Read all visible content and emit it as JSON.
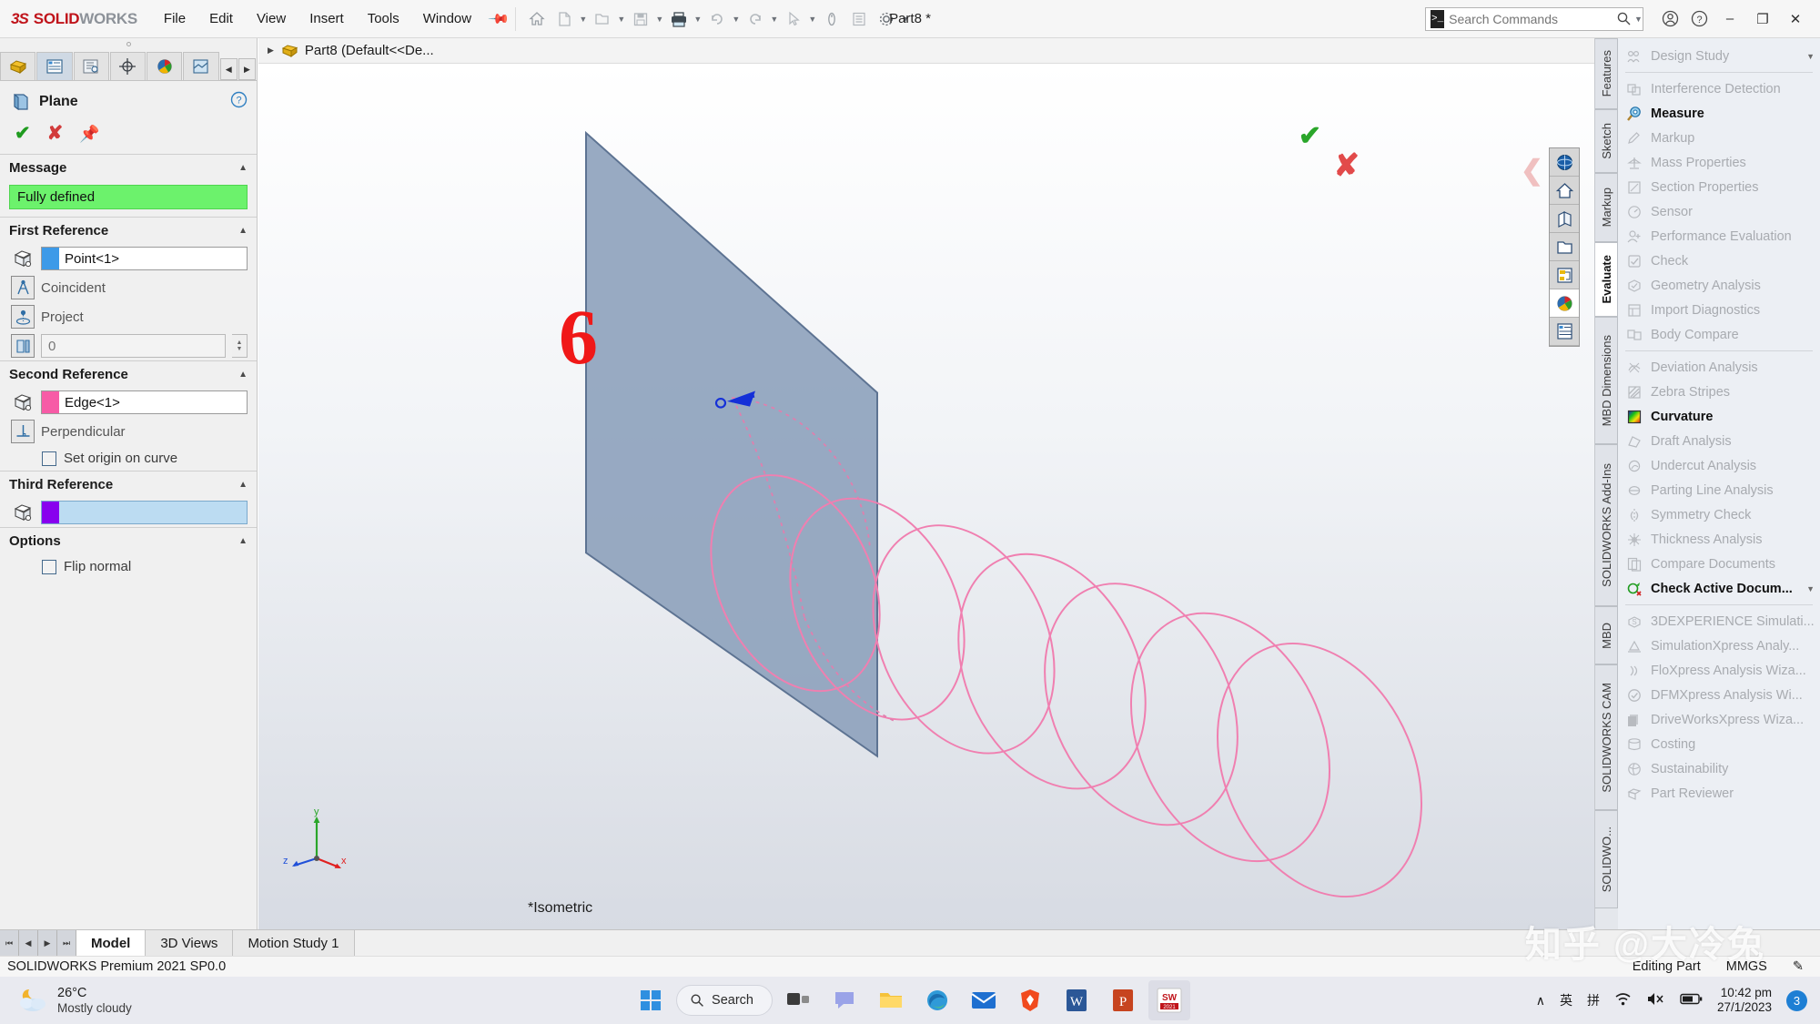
{
  "app": {
    "brand_ds": "3S",
    "brand_solid": "SOLID",
    "brand_works": "WORKS",
    "document_title": "Part8 *",
    "menus": [
      "File",
      "Edit",
      "View",
      "Insert",
      "Tools",
      "Window"
    ],
    "accent_red": "#c0141b"
  },
  "search": {
    "placeholder": "Search Commands",
    "value": ""
  },
  "left_panel": {
    "tabs": [
      "feature-manager-tab",
      "property-manager-tab",
      "configuration-manager-tab",
      "dimxpert-manager-tab",
      "display-manager-tab",
      "cam-manager-tab"
    ],
    "title": "Plane",
    "sections": {
      "message": {
        "header": "Message",
        "status": "Fully defined",
        "status_color": "#6cf26c"
      },
      "first_reference": {
        "header": "First Reference",
        "selection": "Point<1>",
        "selection_color": "#3d9ae8",
        "constraint1": "Coincident",
        "constraint2": "Project",
        "offset_value": "0"
      },
      "second_reference": {
        "header": "Second Reference",
        "selection": "Edge<1>",
        "selection_color": "#f75ba6",
        "constraint1": "Perpendicular",
        "checkbox": "Set origin on curve",
        "checked": false
      },
      "third_reference": {
        "header": "Third Reference",
        "selection": "",
        "selection_color": "#8800ee"
      },
      "options": {
        "header": "Options",
        "checkbox": "Flip normal",
        "checked": false
      }
    }
  },
  "graphics": {
    "doc_node": "Part8  (Default<<De...",
    "view_label": "*Isometric",
    "annotation_number": "6",
    "triad": {
      "x": "x",
      "y": "y",
      "z": "z"
    }
  },
  "right_panel": {
    "tabs": [
      "Features",
      "Sketch",
      "Markup",
      "Evaluate",
      "MBD Dimensions",
      "SOLIDWORKS Add-Ins",
      "MBD",
      "SOLIDWORKS CAM",
      "SOLIDWO..."
    ],
    "selected_tab": "Evaluate",
    "groups": [
      {
        "items": [
          {
            "label": "Design Study",
            "icon": "design-study-icon",
            "enabled": false,
            "dropdown": true
          }
        ]
      },
      {
        "items": [
          {
            "label": "Interference Detection",
            "icon": "interference-detection-icon",
            "enabled": false,
            "dropdown": false
          },
          {
            "label": "Measure",
            "icon": "measure-icon",
            "enabled": true,
            "dropdown": false
          },
          {
            "label": "Markup",
            "icon": "markup-icon",
            "enabled": false,
            "dropdown": false
          },
          {
            "label": "Mass Properties",
            "icon": "mass-properties-icon",
            "enabled": false,
            "dropdown": false
          },
          {
            "label": "Section Properties",
            "icon": "section-properties-icon",
            "enabled": false,
            "dropdown": false
          },
          {
            "label": "Sensor",
            "icon": "sensor-icon",
            "enabled": false,
            "dropdown": false
          },
          {
            "label": "Performance Evaluation",
            "icon": "performance-evaluation-icon",
            "enabled": false,
            "dropdown": false
          },
          {
            "label": "Check",
            "icon": "check-icon",
            "enabled": false,
            "dropdown": false
          },
          {
            "label": "Geometry Analysis",
            "icon": "geometry-analysis-icon",
            "enabled": false,
            "dropdown": false
          },
          {
            "label": "Import Diagnostics",
            "icon": "import-diagnostics-icon",
            "enabled": false,
            "dropdown": false
          },
          {
            "label": "Body Compare",
            "icon": "body-compare-icon",
            "enabled": false,
            "dropdown": false
          }
        ]
      },
      {
        "items": [
          {
            "label": "Deviation Analysis",
            "icon": "deviation-analysis-icon",
            "enabled": false,
            "dropdown": false
          },
          {
            "label": "Zebra Stripes",
            "icon": "zebra-stripes-icon",
            "enabled": false,
            "dropdown": false
          },
          {
            "label": "Curvature",
            "icon": "curvature-icon",
            "enabled": true,
            "dropdown": false
          },
          {
            "label": "Draft Analysis",
            "icon": "draft-analysis-icon",
            "enabled": false,
            "dropdown": false
          },
          {
            "label": "Undercut Analysis",
            "icon": "undercut-analysis-icon",
            "enabled": false,
            "dropdown": false
          },
          {
            "label": "Parting Line Analysis",
            "icon": "parting-line-analysis-icon",
            "enabled": false,
            "dropdown": false
          },
          {
            "label": "Symmetry Check",
            "icon": "symmetry-check-icon",
            "enabled": false,
            "dropdown": false
          },
          {
            "label": "Thickness Analysis",
            "icon": "thickness-analysis-icon",
            "enabled": false,
            "dropdown": false
          },
          {
            "label": "Compare Documents",
            "icon": "compare-documents-icon",
            "enabled": false,
            "dropdown": false
          },
          {
            "label": "Check Active Docum...",
            "icon": "check-active-document-icon",
            "enabled": true,
            "dropdown": true
          }
        ]
      },
      {
        "items": [
          {
            "label": "3DEXPERIENCE Simulati...",
            "icon": "3dexperience-simulation-icon",
            "enabled": false,
            "dropdown": false
          },
          {
            "label": "SimulationXpress Analy...",
            "icon": "simulationxpress-icon",
            "enabled": false,
            "dropdown": false
          },
          {
            "label": "FloXpress Analysis Wiza...",
            "icon": "floxpress-icon",
            "enabled": false,
            "dropdown": false
          },
          {
            "label": "DFMXpress Analysis Wi...",
            "icon": "dfmxpress-icon",
            "enabled": false,
            "dropdown": false
          },
          {
            "label": "DriveWorksXpress Wiza...",
            "icon": "driveworksxpress-icon",
            "enabled": false,
            "dropdown": false
          },
          {
            "label": "Costing",
            "icon": "costing-icon",
            "enabled": false,
            "dropdown": false
          },
          {
            "label": "Sustainability",
            "icon": "sustainability-icon",
            "enabled": false,
            "dropdown": false
          },
          {
            "label": "Part Reviewer",
            "icon": "part-reviewer-icon",
            "enabled": false,
            "dropdown": false
          }
        ]
      }
    ]
  },
  "bottom": {
    "tabs": [
      "Model",
      "3D Views",
      "Motion Study 1"
    ],
    "selected_tab": "Model",
    "status_left": "SOLIDWORKS Premium 2021 SP0.0",
    "status_editing": "Editing Part",
    "status_units": "MMGS"
  },
  "taskbar": {
    "weather_temp": "26°C",
    "weather_desc": "Mostly cloudy",
    "search_label": "Search",
    "apps": [
      "start-button",
      "search-pill",
      "task-view",
      "chat",
      "file-explorer",
      "edge-browser",
      "mail",
      "brave-browser",
      "word",
      "powerpoint",
      "solidworks"
    ],
    "active_app": "solidworks",
    "ime_caret": "∧",
    "ime_lang": "英",
    "ime_mode": "拼",
    "time": "10:42 pm",
    "date": "27/1/2023",
    "notification_count": "3"
  },
  "watermark": "知乎 @大冷兔"
}
